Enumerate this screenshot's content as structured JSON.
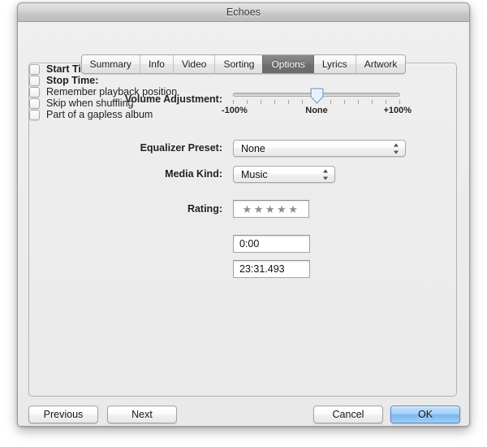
{
  "window": {
    "title": "Echoes"
  },
  "tabs": [
    {
      "label": "Summary",
      "selected": false
    },
    {
      "label": "Info",
      "selected": false
    },
    {
      "label": "Video",
      "selected": false
    },
    {
      "label": "Sorting",
      "selected": false
    },
    {
      "label": "Options",
      "selected": true
    },
    {
      "label": "Lyrics",
      "selected": false
    },
    {
      "label": "Artwork",
      "selected": false
    }
  ],
  "volume": {
    "label": "Volume Adjustment:",
    "min_label": "-100%",
    "mid_label": "None",
    "max_label": "+100%",
    "value_percent": 0,
    "thumb_position_percent": 50,
    "tick_count": 13
  },
  "equalizer": {
    "label": "Equalizer Preset:",
    "value": "None"
  },
  "media_kind": {
    "label": "Media Kind:",
    "value": "Music"
  },
  "rating": {
    "label": "Rating:",
    "stars": "★★★★★",
    "value": 0
  },
  "start_time": {
    "label": "Start Time:",
    "checked": false,
    "value": "0:00"
  },
  "stop_time": {
    "label": "Stop Time:",
    "checked": false,
    "value": "23:31.493"
  },
  "options": [
    {
      "label": "Remember playback position",
      "checked": false
    },
    {
      "label": "Skip when shuffling",
      "checked": false
    },
    {
      "label": "Part of a gapless album",
      "checked": false
    }
  ],
  "buttons": {
    "previous": "Previous",
    "next": "Next",
    "cancel": "Cancel",
    "ok": "OK"
  },
  "colors": {
    "default_button_accent": "#79b8f0",
    "selected_tab_background": "#6e6e6e",
    "window_background": "#ececec",
    "slider_thumb": "#a9cbe8"
  }
}
